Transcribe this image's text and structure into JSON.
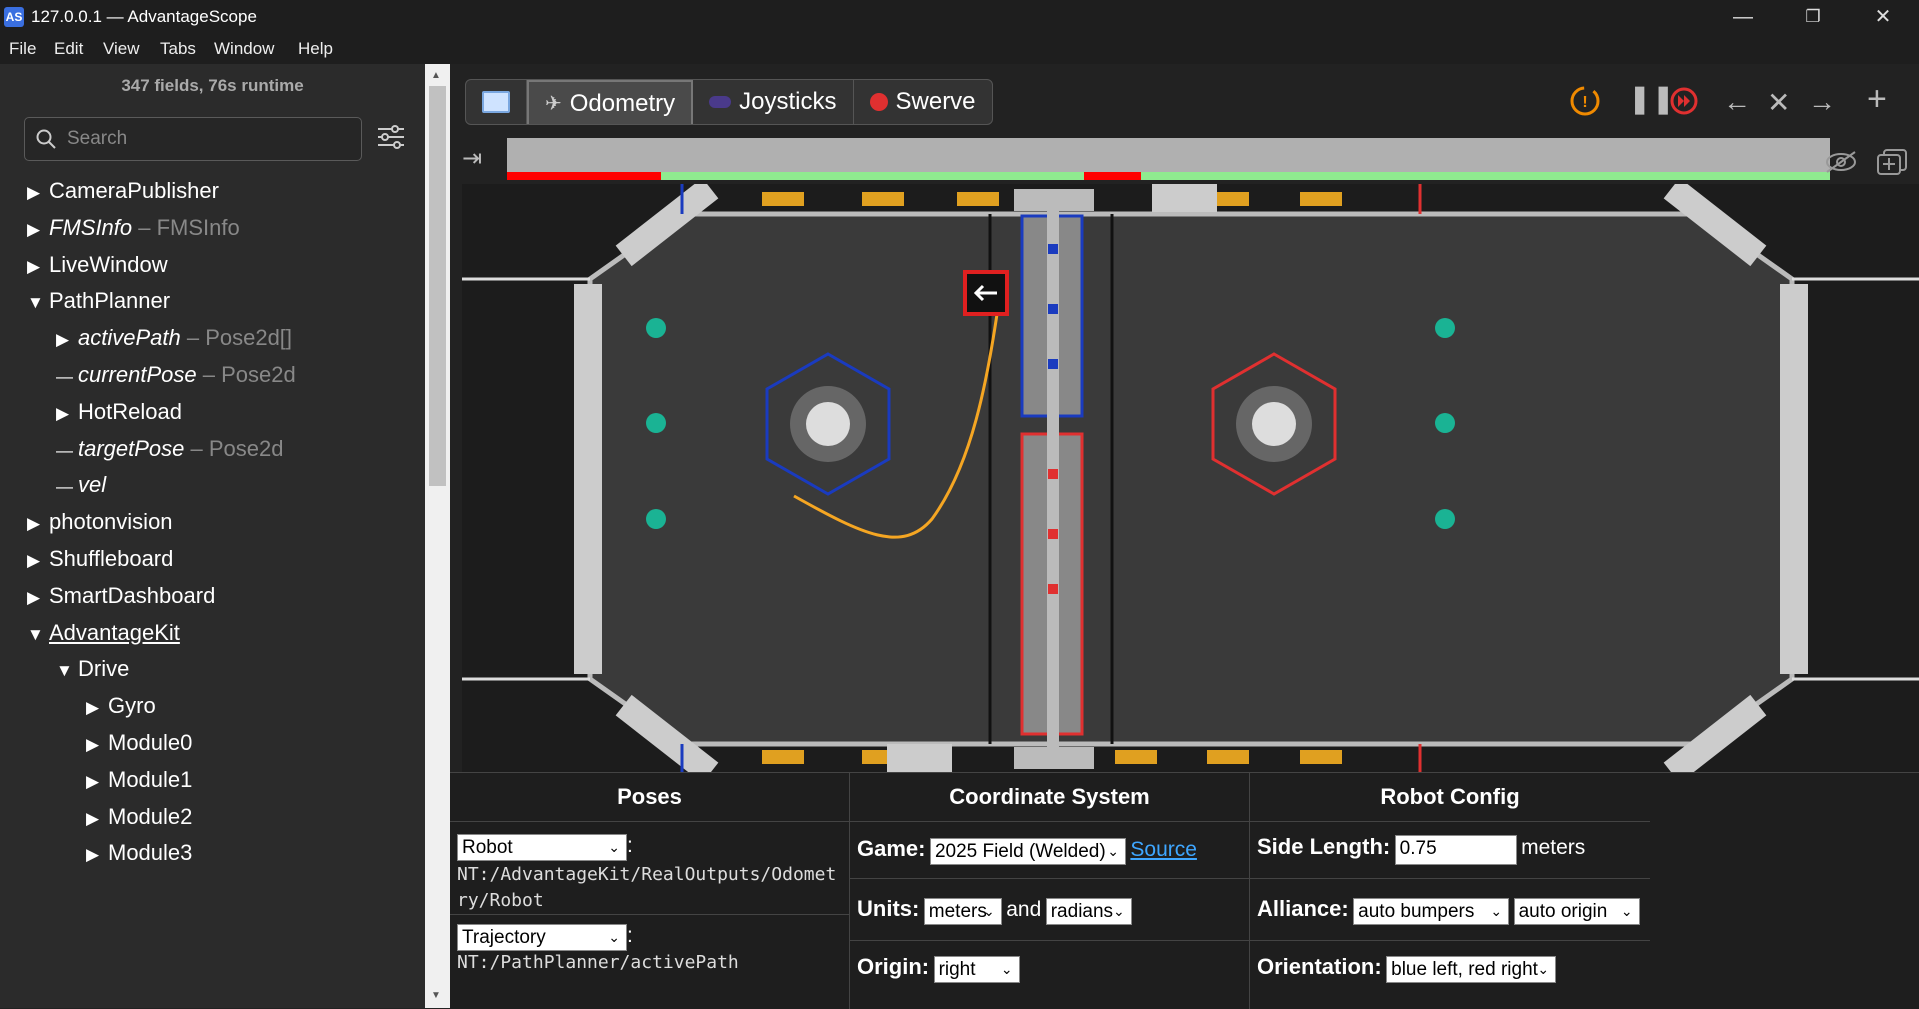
{
  "window": {
    "title": "127.0.0.1 — AdvantageScope",
    "icon": "AS"
  },
  "menu": [
    "File",
    "Edit",
    "View",
    "Tabs",
    "Window",
    "Help"
  ],
  "sidebar": {
    "summary": "347 fields, 76s runtime",
    "search_placeholder": "Search",
    "tree": [
      {
        "label": "CameraPublisher",
        "type": "",
        "expanded": false,
        "indent": 0,
        "italic": false
      },
      {
        "label": "FMSInfo",
        "type": " – FMSInfo",
        "expanded": false,
        "indent": 0,
        "italic": true
      },
      {
        "label": "LiveWindow",
        "type": "",
        "expanded": false,
        "indent": 0,
        "italic": false
      },
      {
        "label": "PathPlanner",
        "type": "",
        "expanded": true,
        "indent": 0,
        "italic": false
      },
      {
        "label": "activePath",
        "type": " – Pose2d[]",
        "expanded": false,
        "indent": 1,
        "italic": true
      },
      {
        "label": "currentPose",
        "type": " – Pose2d",
        "leaf": true,
        "indent": 1,
        "italic": true
      },
      {
        "label": "HotReload",
        "type": "",
        "expanded": false,
        "indent": 1,
        "italic": false
      },
      {
        "label": "targetPose",
        "type": " – Pose2d",
        "leaf": true,
        "indent": 1,
        "italic": true
      },
      {
        "label": "vel",
        "type": "",
        "leaf": true,
        "indent": 1,
        "italic": true
      },
      {
        "label": "photonvision",
        "type": "",
        "expanded": false,
        "indent": 0,
        "italic": false
      },
      {
        "label": "Shuffleboard",
        "type": "",
        "expanded": false,
        "indent": 0,
        "italic": false
      },
      {
        "label": "SmartDashboard",
        "type": "",
        "expanded": false,
        "indent": 0,
        "italic": false
      },
      {
        "label": "AdvantageKit",
        "type": "",
        "expanded": true,
        "indent": 0,
        "italic": false,
        "underline": true
      },
      {
        "label": "Drive",
        "type": "",
        "expanded": true,
        "indent": 1,
        "italic": false
      },
      {
        "label": "Gyro",
        "type": "",
        "expanded": false,
        "indent": 2,
        "italic": false
      },
      {
        "label": "Module0",
        "type": "",
        "expanded": false,
        "indent": 2,
        "italic": false
      },
      {
        "label": "Module1",
        "type": "",
        "expanded": false,
        "indent": 2,
        "italic": false
      },
      {
        "label": "Module2",
        "type": "",
        "expanded": false,
        "indent": 2,
        "italic": false
      },
      {
        "label": "Module3",
        "type": "",
        "expanded": false,
        "indent": 2,
        "italic": false
      }
    ]
  },
  "tabs": [
    {
      "label": "",
      "icon": "book-icon",
      "active": false
    },
    {
      "label": "Odometry",
      "icon": "map-icon",
      "active": true
    },
    {
      "label": "Joysticks",
      "icon": "gamepad-icon",
      "active": false
    },
    {
      "label": "Swerve",
      "icon": "alarm-icon",
      "active": false
    }
  ],
  "controls": [
    "sync-warning-icon",
    "pause-icon",
    "live-icon",
    "arrow-left-icon",
    "close-icon",
    "arrow-right-icon",
    "plus-icon"
  ],
  "panel": {
    "poses": {
      "header": "Poses",
      "items": [
        {
          "type": "Robot",
          "colon": ":",
          "path": "NT:/AdvantageKit/RealOutputs/Odometry/Robot"
        },
        {
          "type": "Trajectory",
          "colon": ":",
          "path": "NT:/PathPlanner/activePath"
        }
      ]
    },
    "coord": {
      "header": "Coordinate System",
      "game_label": "Game:",
      "game_value": "2025 Field (Welded)",
      "source_link": "Source",
      "units_label": "Units:",
      "units_value": "meters",
      "and_text": "and",
      "angle_value": "radians",
      "origin_label": "Origin:",
      "origin_value": "right"
    },
    "robot": {
      "header": "Robot Config",
      "side_label": "Side Length:",
      "side_value": "0.75",
      "side_unit": "meters",
      "alliance_label": "Alliance:",
      "alliance_value": "auto bumpers",
      "origin_value": "auto origin",
      "orient_label": "Orientation:",
      "orient_value": "blue left, red right"
    }
  },
  "colors": {
    "accent_orange": "#f5a623",
    "blue": "#1a3bbf",
    "red": "#e03030",
    "green": "#8fea8f",
    "coral": "#1ab394"
  }
}
